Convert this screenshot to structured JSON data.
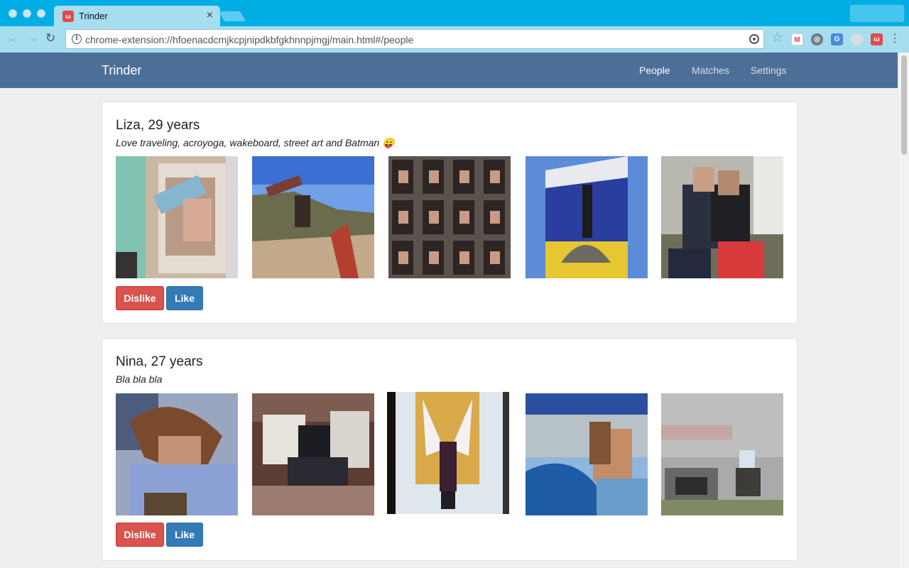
{
  "browser": {
    "tab_title": "Trinder",
    "tab_favicon": "ω",
    "tab_close": "×",
    "url": "chrome-extension://hfoenacdcmjkcpjnipdkbfgkhnnpjmgj/main.html#/people"
  },
  "app": {
    "brand": "Trinder",
    "nav": [
      {
        "label": "People",
        "active": true
      },
      {
        "label": "Matches",
        "active": false
      },
      {
        "label": "Settings",
        "active": false
      }
    ]
  },
  "profiles": [
    {
      "name": "Liza, 29 years",
      "bio": "Love traveling, acroyoga, wakeboard, street art and Batman 😛",
      "photos": [
        "photo-1",
        "photo-2",
        "photo-3",
        "photo-4",
        "photo-5"
      ],
      "dislike_label": "Dislike",
      "like_label": "Like"
    },
    {
      "name": "Nina, 27 years",
      "bio": "Bla bla bla",
      "photos": [
        "photo-1",
        "photo-2",
        "photo-3",
        "photo-4",
        "photo-5"
      ],
      "dislike_label": "Dislike",
      "like_label": "Like"
    }
  ],
  "colors": {
    "tabstrip": "#00aee6",
    "navbar": "#4c6f98",
    "dislike": "#d9534f",
    "like": "#337ab7"
  }
}
